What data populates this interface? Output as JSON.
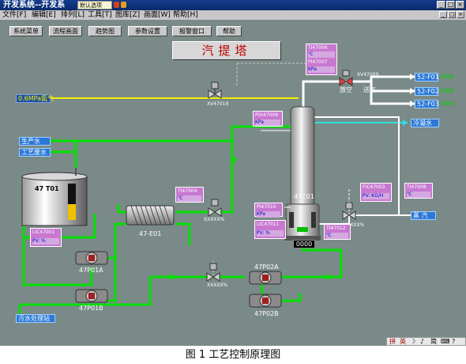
{
  "window": {
    "title": "开发系统--开发系",
    "tooltip": "默认选项",
    "controls": {
      "minimize": "_",
      "maximize": "□",
      "close": "×"
    }
  },
  "menu": {
    "items": [
      {
        "label": "文件[F]"
      },
      {
        "label": "编辑[E]"
      },
      {
        "label": "排列[L]"
      },
      {
        "label": "工具[T]"
      },
      {
        "label": "图库[Z]"
      },
      {
        "label": "画面[W]"
      },
      {
        "label": "帮助[H]"
      }
    ]
  },
  "nav": {
    "buttons": [
      {
        "label": "系统菜单"
      },
      {
        "label": "流程画面"
      },
      {
        "label": "趋势图"
      },
      {
        "label": "参数设置"
      },
      {
        "label": "报警窗口"
      },
      {
        "label": "帮助"
      }
    ]
  },
  "banner": {
    "title": "汽提塔"
  },
  "streams": {
    "nitrogen": "0.6MPa氮气",
    "production_water": "生产水",
    "process_waste_water": "工艺废水",
    "cooling_water": "冷凝水",
    "steam": "蒸 汽",
    "sewage_plant": "污水处理站",
    "furnace1": "52-F01",
    "furnace2": "52-F02",
    "furnace3": "52-F03",
    "furnace_note": "去燃烧",
    "vent": "放空",
    "to_gas": "送气"
  },
  "equipment": {
    "tank": "47 T01",
    "column": "47C01",
    "exchanger": "47-E01",
    "pump_p01a": "47P01A",
    "pump_p01b": "47P01B",
    "pump_p02a": "47P02A",
    "pump_p02b": "47P02B",
    "valve_tag_top": "XV47019",
    "valve_tag_vent": "XV47009",
    "valve_code": "XXXXX%"
  },
  "instruments": {
    "pi47006": {
      "tag": "TI47006",
      "value": "℃"
    },
    "pi47007": {
      "tag": "PI47007",
      "value": "KPa"
    },
    "pi47009": {
      "tag": "PDI47009",
      "value": "KPa"
    },
    "ti47004": {
      "tag": "TI47004",
      "value": "℃"
    },
    "lic47001": {
      "tag": "LIC47001",
      "value": "PV: %"
    },
    "pi47010": {
      "tag": "PI47010",
      "value": "KPa"
    },
    "lic47011": {
      "tag": "LIC47011",
      "value": "PV: %"
    },
    "ti47012": {
      "tag": "TI47012",
      "value": "℃"
    },
    "fic47003": {
      "tag": "FIC47003",
      "value": "PV: KG/H"
    },
    "ti47008": {
      "tag": "TI47008",
      "value": "℃"
    }
  },
  "counter": {
    "value": "0000"
  },
  "tray": {
    "icons": [
      "拼",
      "英",
      "☽",
      "♪",
      "简",
      "⌨",
      "?"
    ]
  },
  "caption": {
    "text": "图 1 工艺控制原理图"
  },
  "colors": {
    "background": "#7a8a88",
    "green_pipe": "#00e000",
    "yellow_pipe": "#f0f000",
    "white_pipe": "#ffffff",
    "cyan_pipe": "#30e0e0",
    "instrument": "#c878d0",
    "stream_box": "#2a78d8"
  }
}
